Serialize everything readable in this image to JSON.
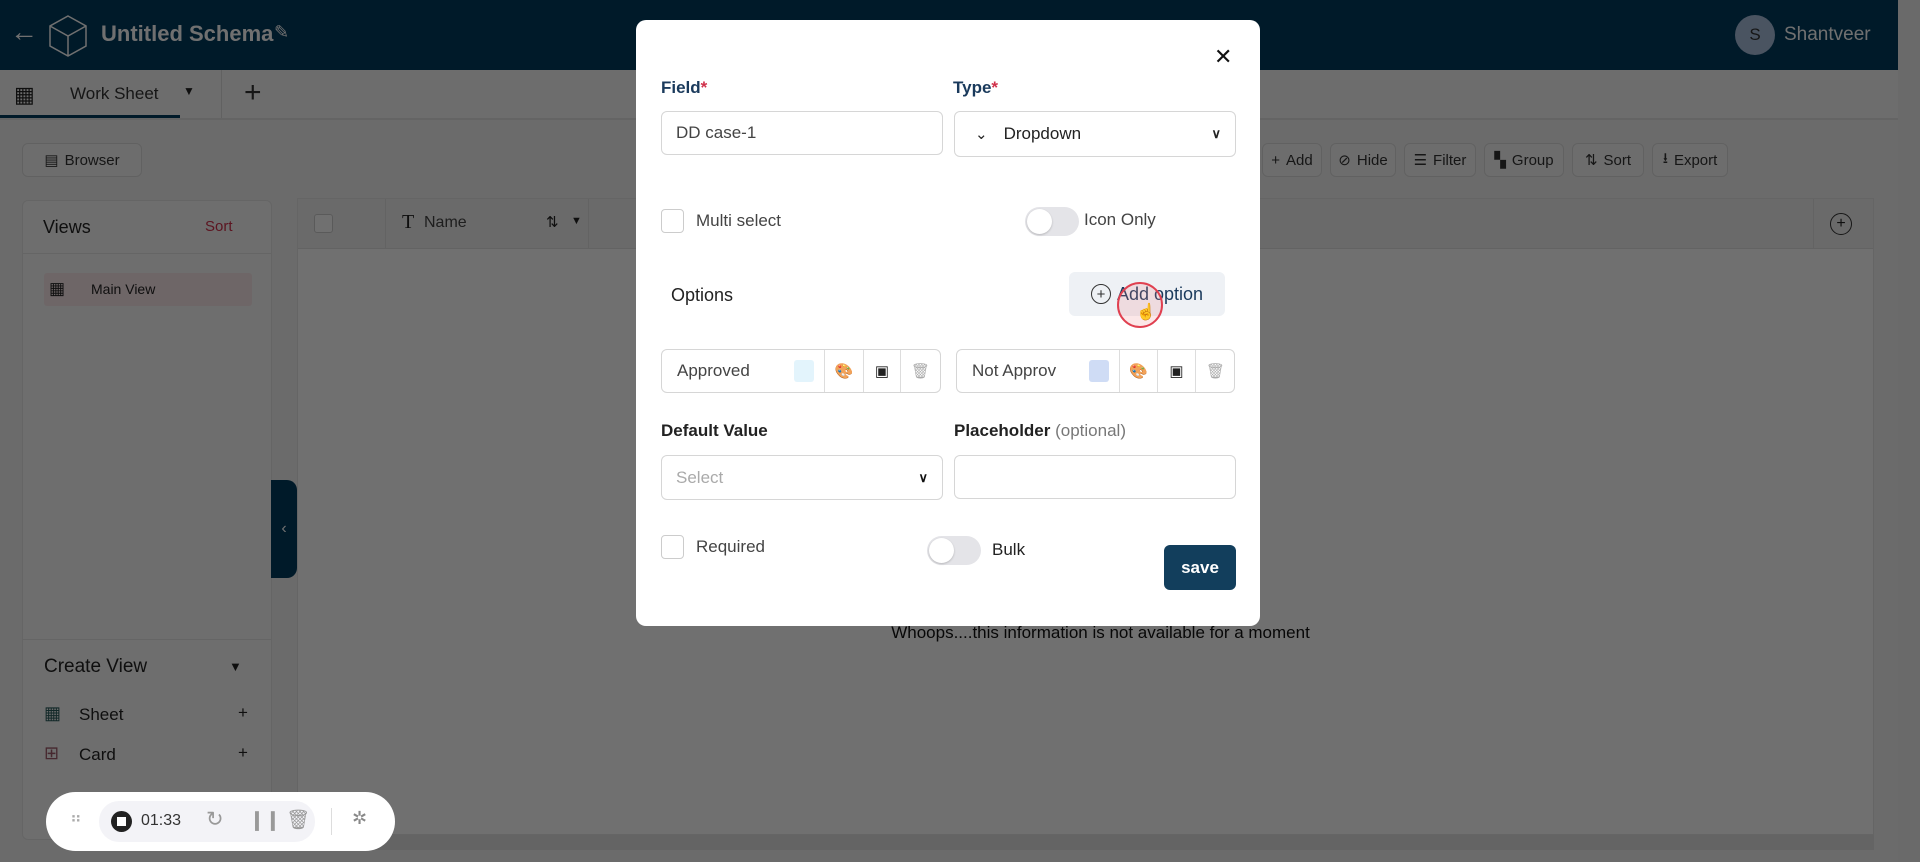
{
  "header": {
    "title": "Untitled Schema",
    "user_initial": "S",
    "user_name": "Shantveer"
  },
  "tabs": [
    {
      "label": "Work Sheet"
    }
  ],
  "toolbar": {
    "browser": "Browser",
    "add": "Add",
    "hide": "Hide",
    "filter": "Filter",
    "group": "Group",
    "sort": "Sort",
    "export": "Export"
  },
  "views": {
    "title": "Views",
    "sort": "Sort",
    "items": [
      {
        "label": "Main View"
      }
    ]
  },
  "create_view": {
    "title": "Create View",
    "items": [
      {
        "label": "Sheet"
      },
      {
        "label": "Card"
      }
    ]
  },
  "table": {
    "columns": [
      {
        "label": "Name"
      }
    ],
    "empty_message": "Whoops....this information is not available for a moment"
  },
  "recorder": {
    "time": "01:33"
  },
  "modal": {
    "field_label": "Field",
    "type_label": "Type",
    "required_mark": "*",
    "field_value": "DD case-1",
    "type_value": "Dropdown",
    "multi_select": "Multi select",
    "icon_only": "Icon Only",
    "options_label": "Options",
    "add_option": "Add option",
    "options": [
      {
        "label": "Approved",
        "color": "#e3f4fc"
      },
      {
        "label": "Not Approv",
        "color": "#cfdcf5"
      }
    ],
    "default_value_label": "Default Value",
    "default_value_placeholder": "Select",
    "placeholder_label": "Placeholder",
    "placeholder_optional": "(optional)",
    "placeholder_value": "",
    "required": "Required",
    "bulk": "Bulk",
    "save": "save"
  },
  "colors": {
    "primary": "#003a5d",
    "accent_red": "#d0304a",
    "save": "#123e5c"
  }
}
